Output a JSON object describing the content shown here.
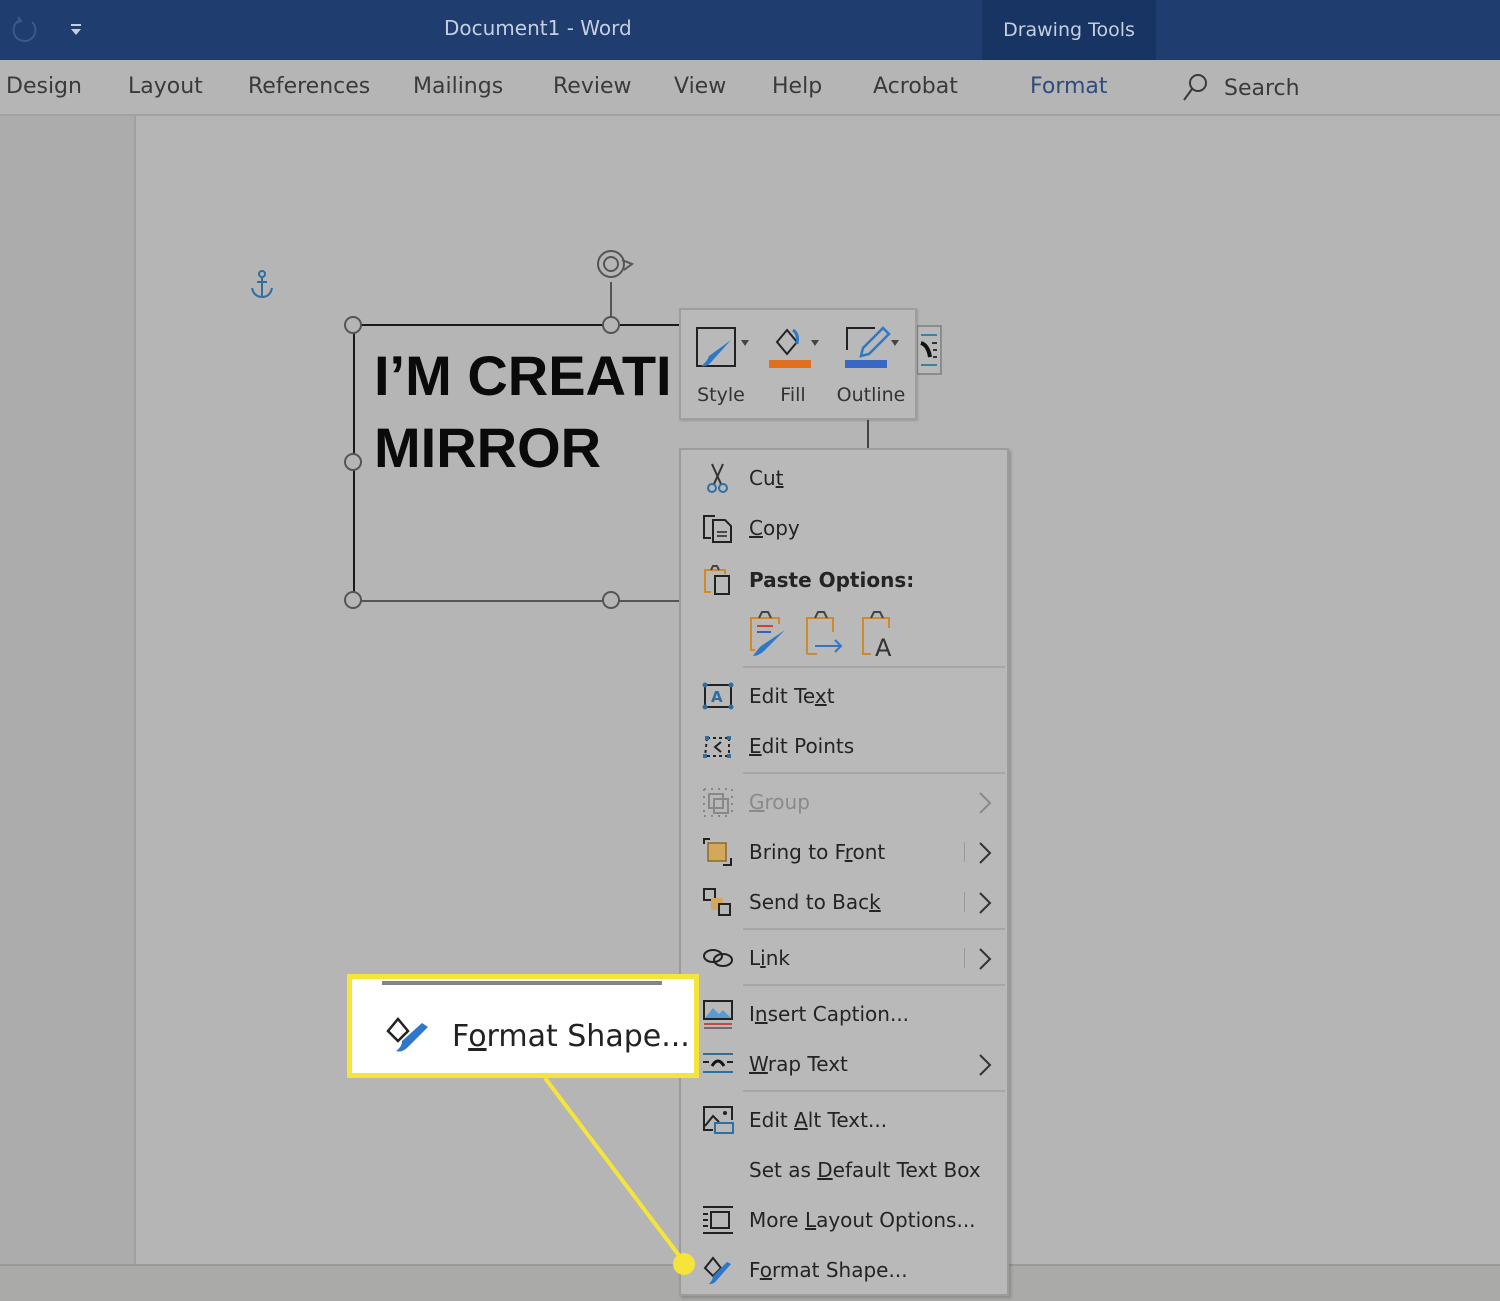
{
  "titlebar": {
    "document_title": "Document1  -  Word",
    "context_tab": "Drawing Tools",
    "icons": {
      "undo": "redo-circular-arrow-icon",
      "qat": "customize-quick-access-icon"
    }
  },
  "ribbon": {
    "tabs": [
      {
        "label": "Design",
        "active": false
      },
      {
        "label": "Layout",
        "active": false
      },
      {
        "label": "References",
        "active": false
      },
      {
        "label": "Mailings",
        "active": false
      },
      {
        "label": "Review",
        "active": false
      },
      {
        "label": "View",
        "active": false
      },
      {
        "label": "Help",
        "active": false
      },
      {
        "label": "Acrobat",
        "active": false
      },
      {
        "label": "Format",
        "active": true
      }
    ],
    "search_label": "Search"
  },
  "document": {
    "textbox_text": "I’M CREATI\nMIRROR"
  },
  "mini_toolbar": {
    "buttons": [
      {
        "label": "Style",
        "icon": "shape-style-icon"
      },
      {
        "label": "Fill",
        "icon": "fill-bucket-icon",
        "color": "#e0701e"
      },
      {
        "label": "Outline",
        "icon": "outline-pen-icon",
        "color": "#3a66c4"
      }
    ]
  },
  "context_menu": {
    "items": [
      {
        "label_pre": "Cu",
        "label_u": "t",
        "label_post": "",
        "icon": "scissors-icon"
      },
      {
        "label_pre": "",
        "label_u": "C",
        "label_post": "opy",
        "icon": "copy-icon"
      },
      {
        "label": "Paste Options:",
        "icon": "paste-icon",
        "bold": true
      },
      {
        "label_pre": "Edit Te",
        "label_u": "x",
        "label_post": "t",
        "icon": "edit-text-icon"
      },
      {
        "label_pre": "",
        "label_u": "E",
        "label_post": "dit Points",
        "icon": "edit-points-icon"
      },
      {
        "label_pre": "",
        "label_u": "G",
        "label_post": "roup",
        "icon": "group-icon",
        "disabled": true,
        "submenu": true
      },
      {
        "label_pre": "Bring to F",
        "label_u": "r",
        "label_post": "ont",
        "icon": "bring-to-front-icon",
        "submenu": true
      },
      {
        "label_pre": "Send to Bac",
        "label_u": "k",
        "label_post": "",
        "icon": "send-to-back-icon",
        "submenu": true
      },
      {
        "label_pre": "L",
        "label_u": "i",
        "label_post": "nk",
        "icon": "link-icon",
        "submenu": true
      },
      {
        "label_pre": "I",
        "label_u": "n",
        "label_post": "sert Caption...",
        "icon": "insert-caption-icon"
      },
      {
        "label_pre": "",
        "label_u": "W",
        "label_post": "rap Text",
        "icon": "wrap-text-icon",
        "submenu": true
      },
      {
        "label_pre": "Edit ",
        "label_u": "A",
        "label_post": "lt Text...",
        "icon": "alt-text-icon"
      },
      {
        "label_pre": "Set as ",
        "label_u": "D",
        "label_post": "efault Text Box",
        "icon": ""
      },
      {
        "label_pre": "More ",
        "label_u": "L",
        "label_post": "ayout Options...",
        "icon": "layout-options-icon"
      },
      {
        "label_pre": "F",
        "label_u": "o",
        "label_post": "rmat Shape...",
        "icon": "format-shape-icon"
      }
    ],
    "paste_options": [
      "keep-source-formatting-icon",
      "merge-formatting-icon",
      "keep-text-only-icon"
    ]
  },
  "callout": {
    "label_pre": "F",
    "label_u": "o",
    "label_post": "rmat Shape...",
    "highlight_color": "#f5e53b"
  }
}
